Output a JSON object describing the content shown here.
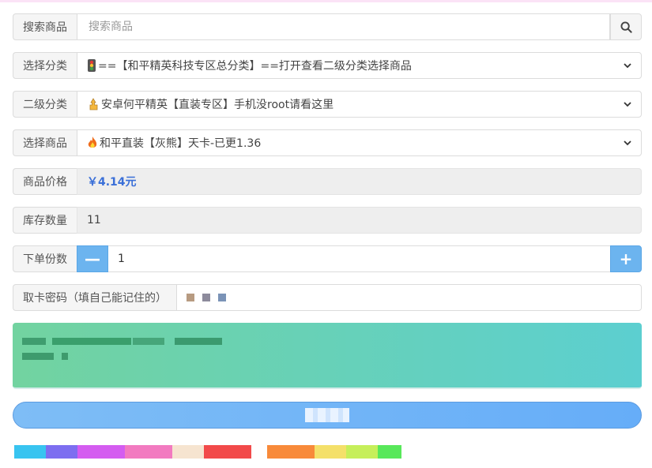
{
  "colors": {
    "accent": "#6cb4ef",
    "price": "#3a6fd8",
    "notice_from": "#72d3a0",
    "notice_to": "#5ccfd0"
  },
  "search": {
    "label": "搜索商品",
    "placeholder": "搜索商品",
    "icon": "search-icon"
  },
  "category": {
    "label": "选择分类",
    "value": "==【和平精英科技专区总分类】==打开查看二级分类选择商品"
  },
  "subcategory": {
    "label": "二级分类",
    "value": "安卓何平精英【直装专区】手机没root请看这里"
  },
  "product": {
    "label": "选择商品",
    "value": "和平直装【灰熊】天卡-已更1.36"
  },
  "price": {
    "label": "商品价格",
    "value": "￥4.14元"
  },
  "stock": {
    "label": "库存数量",
    "value": "11"
  },
  "quantity": {
    "label": "下单份数",
    "value": "1",
    "minus": "—",
    "plus": "+"
  },
  "password": {
    "label": "取卡密码（填自己能记住的）"
  }
}
